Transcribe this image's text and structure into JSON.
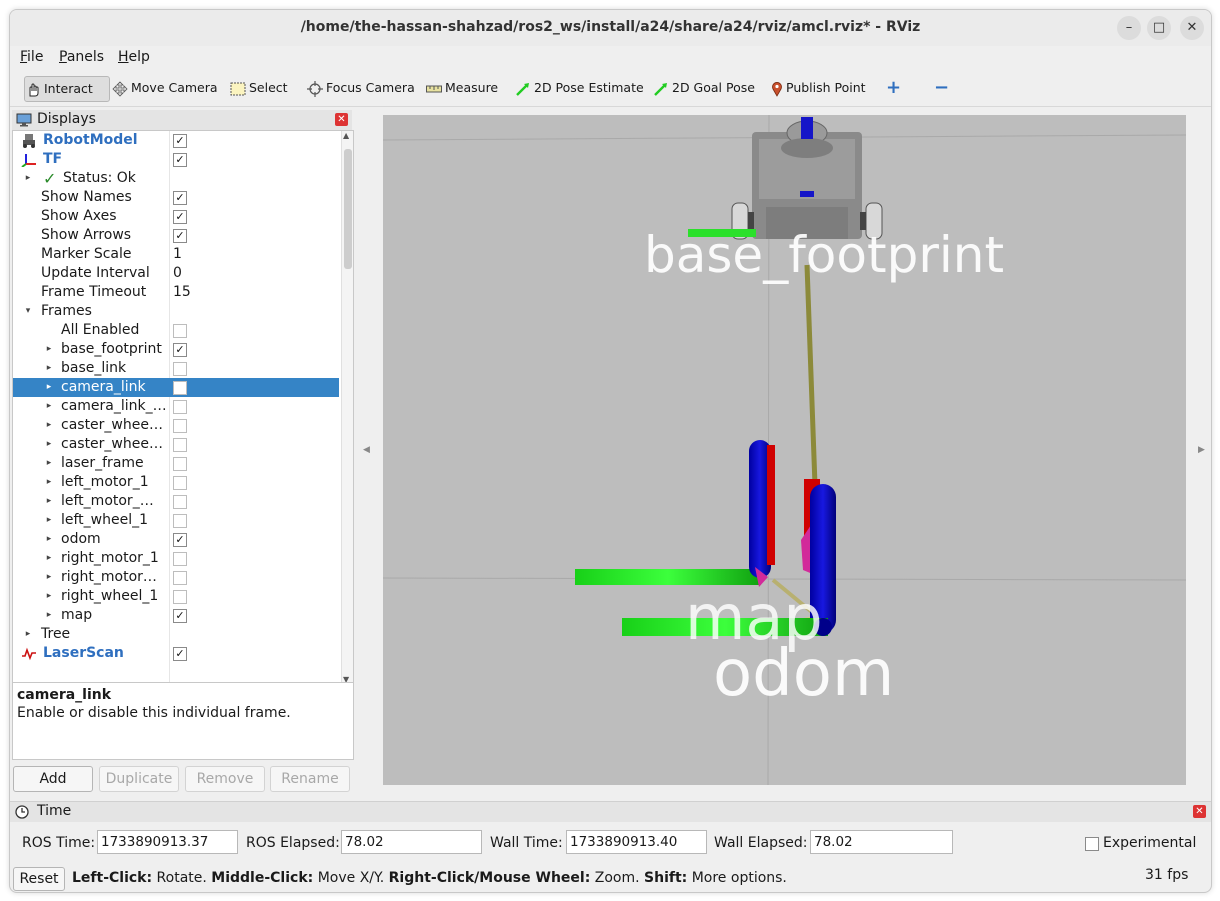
{
  "window": {
    "title": "/home/the-hassan-shahzad/ros2_ws/install/a24/share/a24/rviz/amcl.rviz* - RViz",
    "minimize": "–",
    "maximize": "□",
    "close": "✕"
  },
  "menubar": [
    "File",
    "Panels",
    "Help"
  ],
  "toolbar": {
    "interact": "Interact",
    "move_camera": "Move Camera",
    "select": "Select",
    "focus_camera": "Focus Camera",
    "measure": "Measure",
    "pose_estimate": "2D Pose Estimate",
    "goal_pose": "2D Goal Pose",
    "publish_point": "Publish Point",
    "add_tool": "+",
    "remove_tool": "−"
  },
  "displays_panel": {
    "title": "Displays",
    "rows": [
      {
        "label": "RobotModel",
        "value": "✓",
        "type": "display",
        "expander": ""
      },
      {
        "label": "TF",
        "value": "✓",
        "type": "display",
        "expander": ""
      },
      {
        "label": "Status: Ok",
        "value": "",
        "type": "status",
        "expander": "▸"
      },
      {
        "label": "Show Names",
        "value": "✓",
        "type": "prop",
        "expander": ""
      },
      {
        "label": "Show Axes",
        "value": "✓",
        "type": "prop",
        "expander": ""
      },
      {
        "label": "Show Arrows",
        "value": "✓",
        "type": "prop",
        "expander": ""
      },
      {
        "label": "Marker Scale",
        "value": "1",
        "type": "text",
        "expander": ""
      },
      {
        "label": "Update Interval",
        "value": "0",
        "type": "text",
        "expander": ""
      },
      {
        "label": "Frame Timeout",
        "value": "15",
        "type": "text",
        "expander": ""
      },
      {
        "label": "Frames",
        "value": "",
        "type": "group",
        "expander": "▾"
      },
      {
        "label": "All Enabled",
        "value": "",
        "type": "frame",
        "expander": ""
      },
      {
        "label": "base_footprint",
        "value": "✓",
        "type": "frame",
        "expander": "▸"
      },
      {
        "label": "base_link",
        "value": "",
        "type": "frame",
        "expander": "▸"
      },
      {
        "label": "camera_link",
        "value": "",
        "type": "frame",
        "expander": "▸"
      },
      {
        "label": "camera_link_…",
        "value": "",
        "type": "frame",
        "expander": "▸"
      },
      {
        "label": "caster_whee…",
        "value": "",
        "type": "frame",
        "expander": "▸"
      },
      {
        "label": "caster_whee…",
        "value": "",
        "type": "frame",
        "expander": "▸"
      },
      {
        "label": "laser_frame",
        "value": "",
        "type": "frame",
        "expander": "▸"
      },
      {
        "label": "left_motor_1",
        "value": "",
        "type": "frame",
        "expander": "▸"
      },
      {
        "label": "left_motor_…",
        "value": "",
        "type": "frame",
        "expander": "▸"
      },
      {
        "label": "left_wheel_1",
        "value": "",
        "type": "frame",
        "expander": "▸"
      },
      {
        "label": "odom",
        "value": "✓",
        "type": "frame",
        "expander": "▸"
      },
      {
        "label": "right_motor_1",
        "value": "",
        "type": "frame",
        "expander": "▸"
      },
      {
        "label": "right_motor…",
        "value": "",
        "type": "frame",
        "expander": "▸"
      },
      {
        "label": "right_wheel_1",
        "value": "",
        "type": "frame",
        "expander": "▸"
      },
      {
        "label": "map",
        "value": "✓",
        "type": "frame",
        "expander": "▸"
      },
      {
        "label": "Tree",
        "value": "",
        "type": "group",
        "expander": "▸"
      },
      {
        "label": "LaserScan",
        "value": "✓",
        "type": "display",
        "expander": ""
      }
    ],
    "selected_row": 13
  },
  "description": {
    "title": "camera_link",
    "text": "Enable or disable this individual frame."
  },
  "panel_buttons": {
    "add": "Add",
    "duplicate": "Duplicate",
    "remove": "Remove",
    "rename": "Rename"
  },
  "viewport": {
    "labels": {
      "base_footprint": "base_footprint",
      "map": "map",
      "odom": "odom"
    }
  },
  "time_panel": {
    "title": "Time",
    "ros_time_label": "ROS Time:",
    "ros_time": "1733890913.37",
    "ros_elapsed_label": "ROS Elapsed:",
    "ros_elapsed": "78.02",
    "wall_time_label": "Wall Time:",
    "wall_time": "1733890913.40",
    "wall_elapsed_label": "Wall Elapsed:",
    "wall_elapsed": "78.02",
    "experimental": "Experimental"
  },
  "statusbar": {
    "reset": "Reset",
    "hint_left_key": "Left-Click:",
    "hint_left": " Rotate. ",
    "hint_middle_key": "Middle-Click:",
    "hint_middle": " Move X/Y. ",
    "hint_right_key": "Right-Click/Mouse Wheel:",
    "hint_right": " Zoom. ",
    "hint_shift_key": "Shift:",
    "hint_shift": " More options.",
    "fps": "31 fps"
  },
  "colors": {
    "selection": "#3584c6",
    "display_name": "#2f6fbf",
    "axis_x": "#ff0000",
    "axis_y": "#00ee00",
    "axis_z": "#0000ee",
    "viewport_bg": "#bdbdbd"
  }
}
